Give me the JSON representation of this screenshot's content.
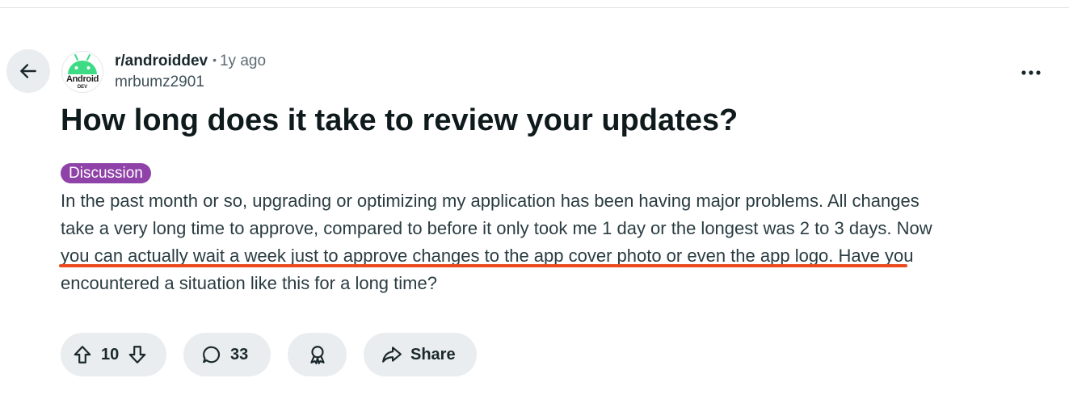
{
  "colors": {
    "accent_underline": "#ea4b1e",
    "flair_bg": "#8f42a8",
    "pill_bg": "#eaedef",
    "android_green": "#3ddc84"
  },
  "nav": {
    "back_icon": "arrow-left-icon"
  },
  "post": {
    "avatar": {
      "icon": "android-logo-icon",
      "text": "Android",
      "subtext": "DEV"
    },
    "subreddit": "r/androiddev",
    "separator": "•",
    "time_ago": "1y ago",
    "author": "mrbumz2901",
    "more_icon": "more-horizontal-icon",
    "title": "How long does it take to review your updates?",
    "flair": "Discussion",
    "body_lines": [
      "In the past month or so, upgrading or optimizing my application has been having major problems. All changes",
      "take a very long time to approve, compared to before it only took me 1 day or the longest was 2 to 3 days. Now",
      "you can actually wait a week just to approve changes to the app cover photo or even the app logo. Have you",
      "encountered a situation like this for a long time?"
    ]
  },
  "actions": {
    "upvote_icon": "arrow-up-icon",
    "vote_count": "10",
    "downvote_icon": "arrow-down-icon",
    "comment_icon": "comment-icon",
    "comment_count": "33",
    "award_icon": "award-icon",
    "share_icon": "share-icon",
    "share_label": "Share"
  }
}
